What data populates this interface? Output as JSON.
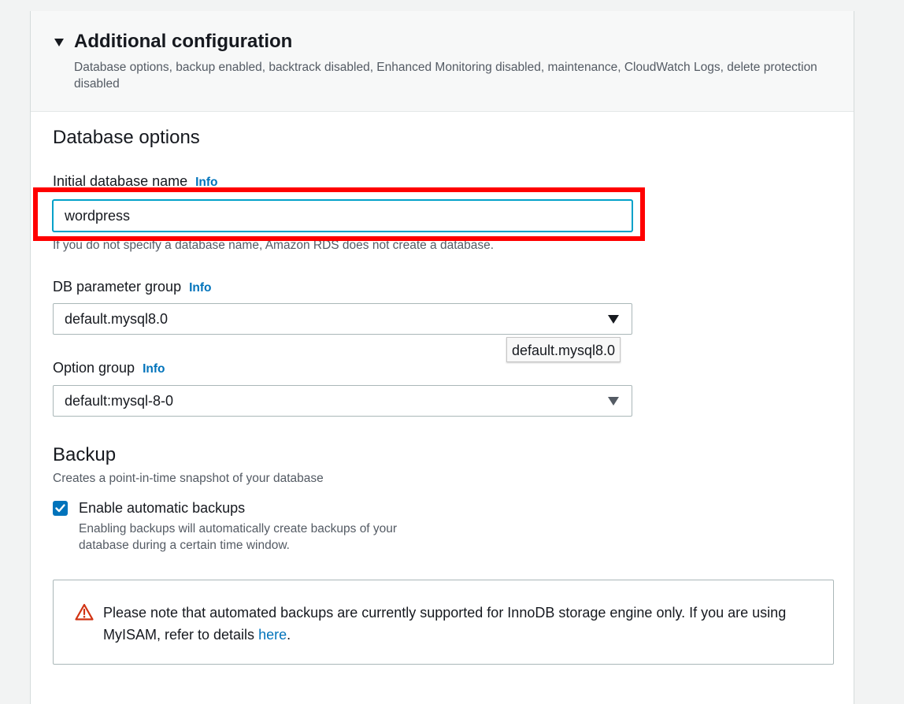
{
  "header": {
    "title": "Additional configuration",
    "description": "Database options, backup enabled, backtrack disabled, Enhanced Monitoring disabled, maintenance, CloudWatch Logs, delete protection disabled"
  },
  "database_options": {
    "section_title": "Database options",
    "initial_db_name": {
      "label": "Initial database name",
      "info": "Info",
      "value": "wordpress",
      "hint": "If you do not specify a database name, Amazon RDS does not create a database."
    },
    "parameter_group": {
      "label": "DB parameter group",
      "info": "Info",
      "selected": "default.mysql8.0",
      "tooltip": "default.mysql8.0"
    },
    "option_group": {
      "label": "Option group",
      "info": "Info",
      "selected": "default:mysql-8-0"
    }
  },
  "backup": {
    "section_title": "Backup",
    "subtitle": "Creates a point-in-time snapshot of your database",
    "enable_checkbox": {
      "label": "Enable automatic backups",
      "description": "Enabling backups will automatically create backups of your database during a certain time window.",
      "checked": true
    },
    "alert": {
      "text_before": "Please note that automated backups are currently supported for InnoDB storage engine only. If you are using MyISAM, refer to details ",
      "link": "here",
      "text_after": "."
    }
  },
  "colors": {
    "accent": "#0073bb",
    "focus": "#00a1c9",
    "highlight": "#ff0000",
    "warning": "#d13212"
  }
}
